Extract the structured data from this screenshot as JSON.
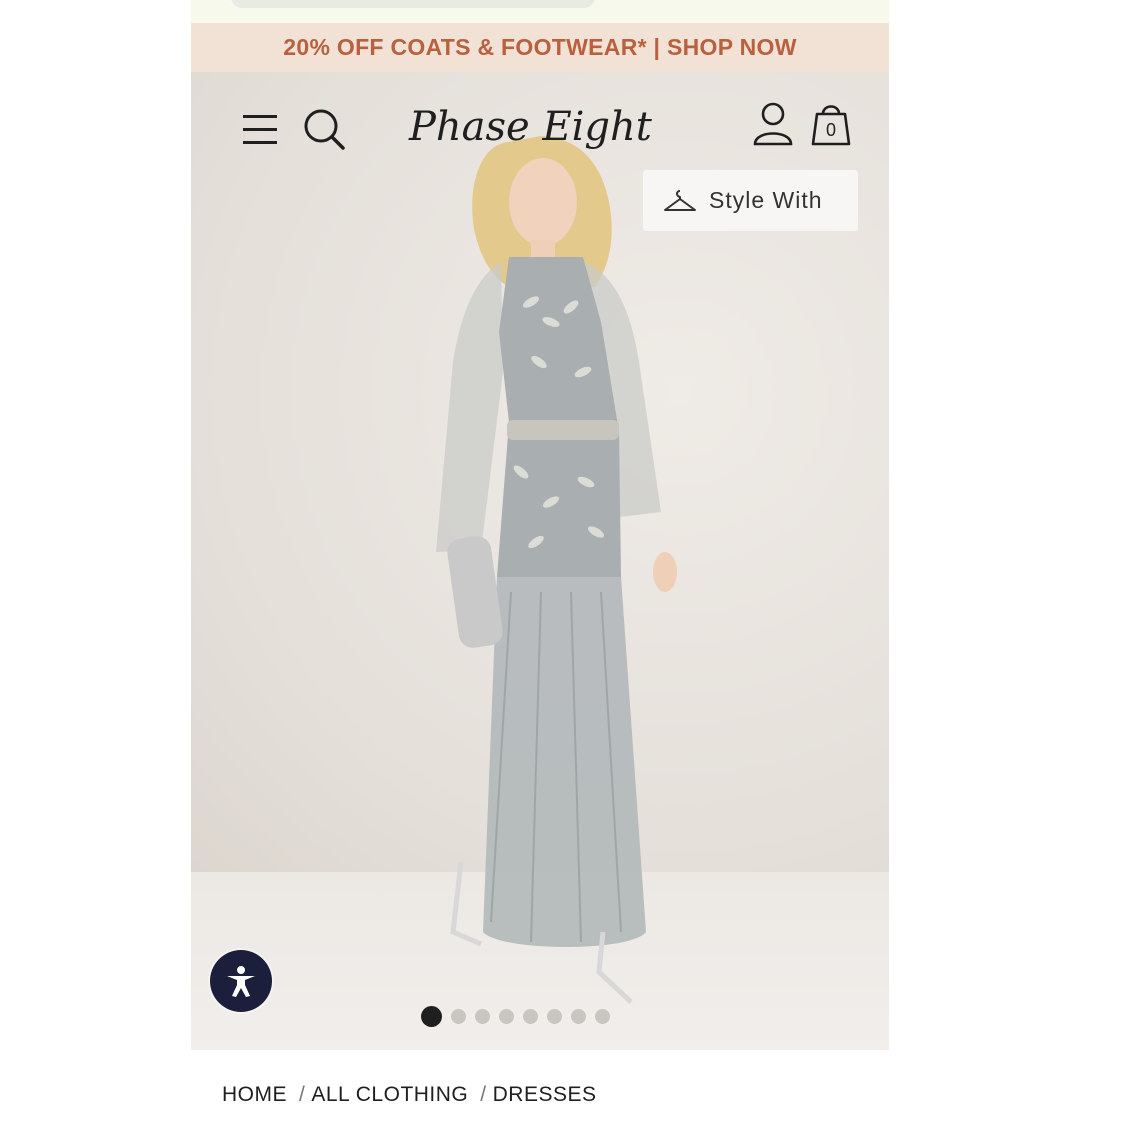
{
  "promo": {
    "text": "20% OFF COATS & FOOTWEAR* | SHOP NOW"
  },
  "header": {
    "logo_text": "Phase Eight",
    "bag_count": "0"
  },
  "hero": {
    "style_with_label": "Style With",
    "carousel": {
      "total_slides": 8,
      "active_index": 0
    }
  },
  "breadcrumb": {
    "items": [
      "HOME",
      "ALL CLOTHING",
      "DRESSES"
    ],
    "separator": "/"
  },
  "colors": {
    "promo_bg": "#f2e1d5",
    "promo_text": "#b9613f",
    "accessibility_button": "#1b1f3b"
  }
}
